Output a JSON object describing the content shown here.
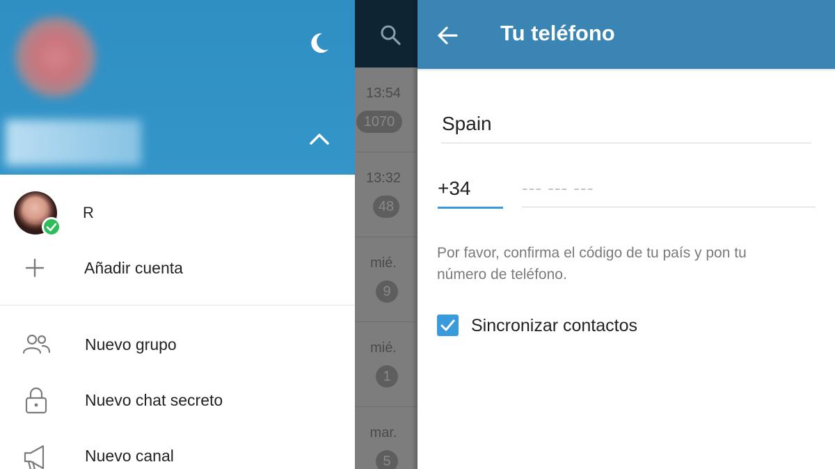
{
  "drawer": {
    "account": {
      "name": "R"
    },
    "add_account_label": "Añadir cuenta",
    "menu": [
      {
        "label": "Nuevo grupo",
        "icon": "group-icon"
      },
      {
        "label": "Nuevo chat secreto",
        "icon": "lock-icon"
      },
      {
        "label": "Nuevo canal",
        "icon": "megaphone-icon"
      }
    ]
  },
  "chats": [
    {
      "time": "13:54",
      "badge": "1070"
    },
    {
      "time": "13:32",
      "badge": "48"
    },
    {
      "time": "mié.",
      "badge": "9"
    },
    {
      "time": "mié.",
      "badge": "1"
    },
    {
      "time": "mar.",
      "badge": "5"
    }
  ],
  "panel": {
    "title": "Tu teléfono",
    "country": "Spain",
    "country_code": "+34",
    "phone_placeholder": "--- --- ---",
    "help_text": "Por favor, confirma el código de tu país y pon tu número de teléfono.",
    "sync_contacts_label": "Sincronizar contactos",
    "sync_contacts_checked": true
  },
  "colors": {
    "header_blue": "#3495c9",
    "topbar_blue": "#3a85b4",
    "accent_blue": "#3a9bdc",
    "online_green": "#2ebd5b"
  }
}
